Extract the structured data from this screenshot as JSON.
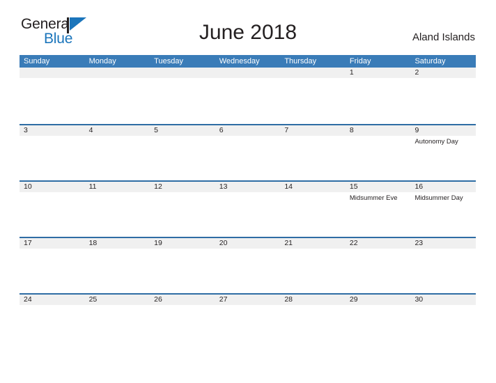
{
  "brand": {
    "name_part1": "General",
    "name_part2": "Blue",
    "flag_icon": "flag-triangle-icon",
    "color_dark": "#231f20",
    "color_blue": "#1b75bb"
  },
  "header": {
    "title": "June 2018",
    "country": "Aland Islands"
  },
  "theme": {
    "header_blue": "#3a7cb8",
    "rule_blue": "#2e6da4",
    "band_gray": "#f0f0f0",
    "text_dark": "#231f20"
  },
  "calendar": {
    "weekdays": [
      "Sunday",
      "Monday",
      "Tuesday",
      "Wednesday",
      "Thursday",
      "Friday",
      "Saturday"
    ],
    "weeks": [
      [
        {
          "date": "",
          "events": []
        },
        {
          "date": "",
          "events": []
        },
        {
          "date": "",
          "events": []
        },
        {
          "date": "",
          "events": []
        },
        {
          "date": "",
          "events": []
        },
        {
          "date": "1",
          "events": []
        },
        {
          "date": "2",
          "events": []
        }
      ],
      [
        {
          "date": "3",
          "events": []
        },
        {
          "date": "4",
          "events": []
        },
        {
          "date": "5",
          "events": []
        },
        {
          "date": "6",
          "events": []
        },
        {
          "date": "7",
          "events": []
        },
        {
          "date": "8",
          "events": []
        },
        {
          "date": "9",
          "events": [
            "Autonomy Day"
          ]
        }
      ],
      [
        {
          "date": "10",
          "events": []
        },
        {
          "date": "11",
          "events": []
        },
        {
          "date": "12",
          "events": []
        },
        {
          "date": "13",
          "events": []
        },
        {
          "date": "14",
          "events": []
        },
        {
          "date": "15",
          "events": [
            "Midsummer Eve"
          ]
        },
        {
          "date": "16",
          "events": [
            "Midsummer Day"
          ]
        }
      ],
      [
        {
          "date": "17",
          "events": []
        },
        {
          "date": "18",
          "events": []
        },
        {
          "date": "19",
          "events": []
        },
        {
          "date": "20",
          "events": []
        },
        {
          "date": "21",
          "events": []
        },
        {
          "date": "22",
          "events": []
        },
        {
          "date": "23",
          "events": []
        }
      ],
      [
        {
          "date": "24",
          "events": []
        },
        {
          "date": "25",
          "events": []
        },
        {
          "date": "26",
          "events": []
        },
        {
          "date": "27",
          "events": []
        },
        {
          "date": "28",
          "events": []
        },
        {
          "date": "29",
          "events": []
        },
        {
          "date": "30",
          "events": []
        }
      ]
    ]
  }
}
